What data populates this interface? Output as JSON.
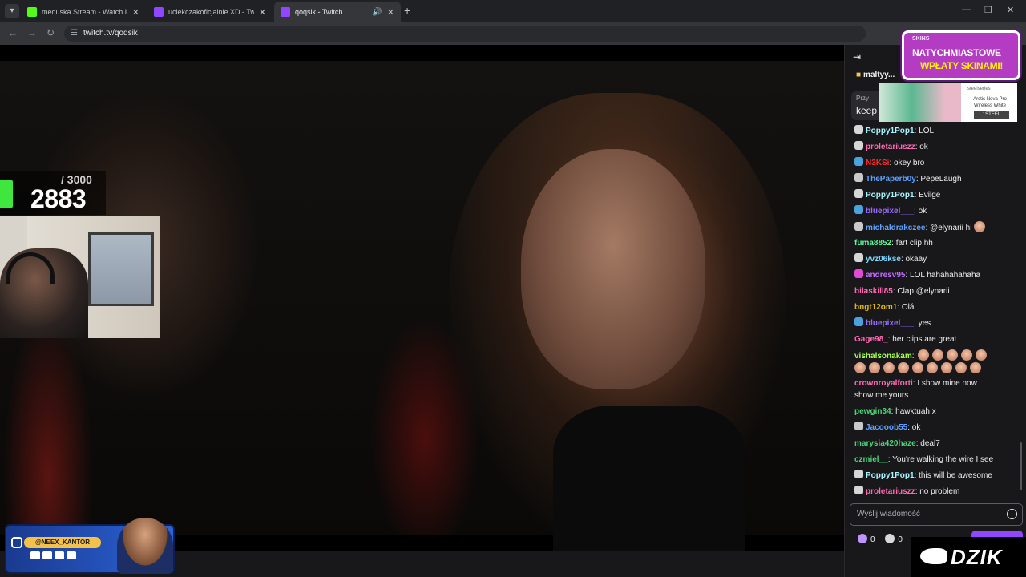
{
  "browser": {
    "tabs": [
      {
        "title": "meduska Stream - Watch Live o",
        "favicon_color": "#53fc18"
      },
      {
        "title": "uciekczakoficjalnie XD - Twitch",
        "favicon_color": "#9147ff"
      },
      {
        "title": "qoqsik - Twitch",
        "favicon_color": "#9147ff"
      }
    ],
    "url": "twitch.tv/qoqsik"
  },
  "overlay": {
    "counter_total": "/ 3000",
    "counter_value": "2883",
    "promo_handle": "@NEEX_KANTOR"
  },
  "chat": {
    "gift_user": "maltyy...",
    "pinned_label": "Przy",
    "pinned_text": "keep",
    "ad_top": {
      "brand": "SKINS",
      "line1": "NATYCHMIASTOWE",
      "line2": "WPŁATY SKINAMI!"
    },
    "ad_second": {
      "brand": "steelseries",
      "product": "Arctis Nova Pro Wireless White",
      "code": "1STEEL"
    },
    "messages": [
      {
        "user": "Poppy1Pop1",
        "color": "#a7f3ff",
        "badge": "#d6d6d6",
        "text": ": LOL"
      },
      {
        "user": "proletariuszz",
        "color": "#ff69b4",
        "badge": "#d6d6d6",
        "text": ": ok"
      },
      {
        "user": "N3KSi",
        "color": "#ff2a2a",
        "badge": "#4aa3df",
        "text": ": okey bro"
      },
      {
        "user": "ThePaperb0y",
        "color": "#5ea2ff",
        "badge": "#c9c9c9",
        "text": ": PepeLaugh"
      },
      {
        "user": "Poppy1Pop1",
        "color": "#a7f3ff",
        "badge": "#d6d6d6",
        "text": ": Evilge"
      },
      {
        "user": "bluepixel___",
        "color": "#9b6bff",
        "badge": "#4aa3df",
        "text": ": ok"
      },
      {
        "user": "michaldrakczee",
        "color": "#5ea2ff",
        "badge": "#c9c9c9",
        "text": ": @elynarii hi"
      },
      {
        "user": "fuma8852",
        "color": "#55ff9a",
        "badge": "",
        "text": ": fart clip hh"
      },
      {
        "user": "yvz06kse",
        "color": "#7fd6ff",
        "badge": "#d6d6d6",
        "text": ": okaay"
      },
      {
        "user": "andresv95",
        "color": "#c16bff",
        "badge": "#e04ad6",
        "text": ": LOL hahahahahaha"
      },
      {
        "user": "bilaskill85",
        "color": "#ff69b4",
        "badge": "",
        "text": ": Clap @elynarii"
      },
      {
        "user": "bngt12om1",
        "color": "#e6b800",
        "badge": "",
        "text": ": Olá"
      },
      {
        "user": "bluepixel___",
        "color": "#9b6bff",
        "badge": "#4aa3df",
        "text": ": yes"
      },
      {
        "user": "Gage98_",
        "color": "#ff69b4",
        "badge": "",
        "text": ": her clips are great"
      },
      {
        "user": "vishalsonakam",
        "color": "#a6ff4d",
        "badge": "",
        "text": ":"
      },
      {
        "user": "crownroyalforti",
        "color": "#ff69b4",
        "badge": "",
        "text": ": I show mine now"
      },
      {
        "user": "",
        "color": "#efeff1",
        "badge": "",
        "text": "show me yours"
      },
      {
        "user": "pewgin34",
        "color": "#4dd27a",
        "badge": "",
        "text": ": hawktuah x"
      },
      {
        "user": "Jacooob55",
        "color": "#5ea2ff",
        "badge": "#c9c9c9",
        "text": ": ok"
      },
      {
        "user": "marysia420haze",
        "color": "#4dd27a",
        "badge": "",
        "text": ": deal7"
      },
      {
        "user": "czmiel__",
        "color": "#4dd27a",
        "badge": "",
        "text": ": You're walking the wire I see"
      },
      {
        "user": "Poppy1Pop1",
        "color": "#a7f3ff",
        "badge": "#d6d6d6",
        "text": ": this will be awesome"
      },
      {
        "user": "proletariuszz",
        "color": "#ff69b4",
        "badge": "#d6d6d6",
        "text": ": no problem"
      }
    ],
    "input_placeholder": "Wyślij wiadomość",
    "bits_count": "0",
    "points_count": "0"
  },
  "sponsor": {
    "word": "DZIK"
  }
}
